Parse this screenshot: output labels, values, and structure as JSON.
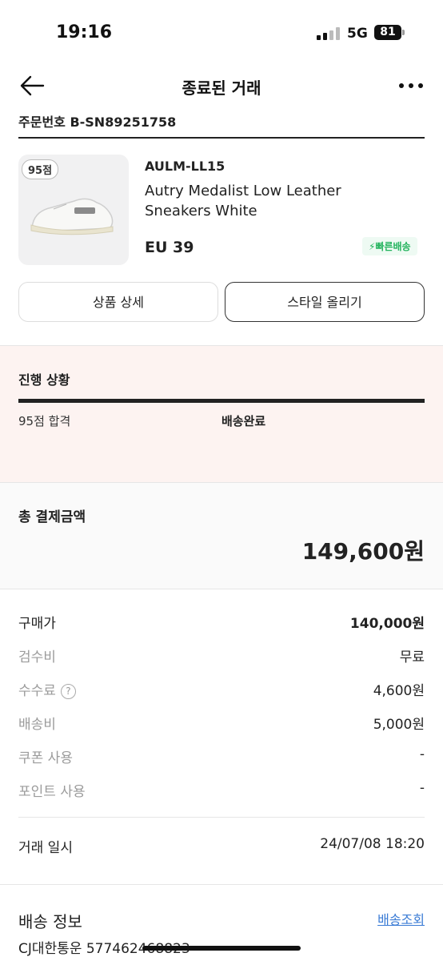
{
  "status_bar": {
    "time": "19:16",
    "network": "5G",
    "battery": "81"
  },
  "header": {
    "title": "종료된 거래",
    "back_icon": "arrow-left-icon",
    "more_icon": "more-horizontal-icon"
  },
  "order": {
    "label": "주문번호 B-SN89251758"
  },
  "product": {
    "grade_badge": "95점",
    "model": "AULM-LL15",
    "name": "Autry Medalist Low Leather Sneakers White",
    "size": "EU 39",
    "shipping_tag": "빠른배송"
  },
  "actions": {
    "detail_button": "상품 상세",
    "style_button": "스타일 올리기"
  },
  "progress": {
    "title": "진행 상황",
    "step_inspection": "95점 합격",
    "step_delivery": "배송완료"
  },
  "total": {
    "label": "총 결제금액",
    "value": "149,600원"
  },
  "breakdown": [
    {
      "label": "구매가",
      "value": "140,000원"
    },
    {
      "label": "검수비",
      "value": "무료"
    },
    {
      "label": "수수료",
      "value": "4,600원"
    },
    {
      "label": "배송비",
      "value": "5,000원"
    },
    {
      "label": "쿠폰 사용",
      "value": "-"
    },
    {
      "label": "포인트 사용",
      "value": "-"
    }
  ],
  "trade_date": {
    "label": "거래 일시",
    "value": "24/07/08 18:20"
  },
  "shipping": {
    "label": "배송 정보",
    "link": "배송조회",
    "info": "CJ대한통운 577462468823"
  },
  "colors": {
    "accent_green": "#23b35d",
    "link_blue": "#3a7bd5",
    "progress_bg": "#fdf3f1"
  }
}
